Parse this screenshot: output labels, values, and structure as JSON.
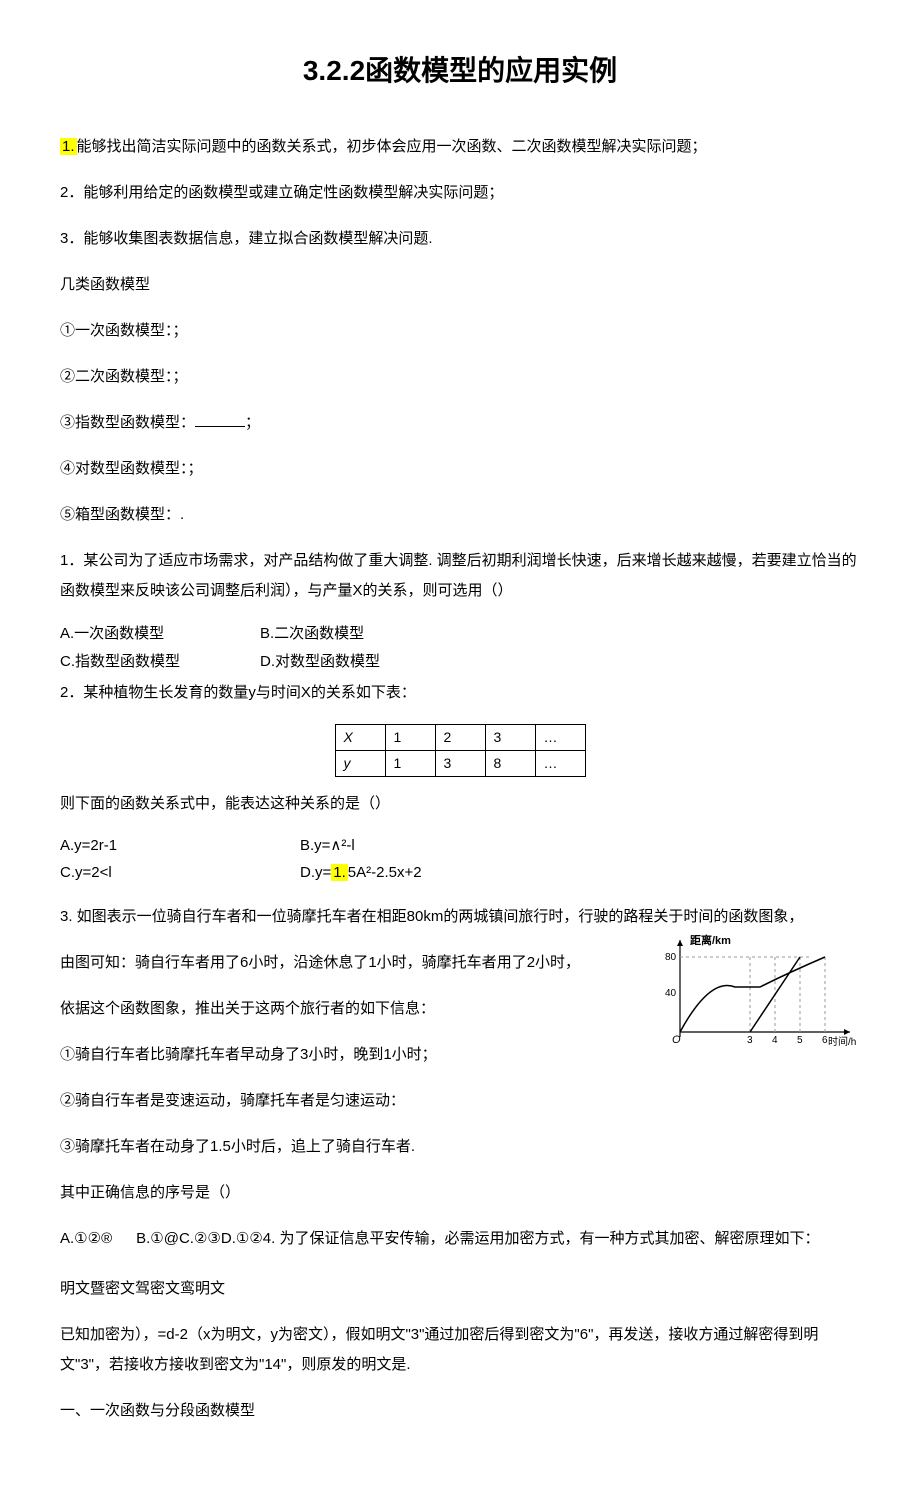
{
  "title": "3.2.2函数模型的应用实例",
  "p1_hi": "1.",
  "p1": "能够找出简洁实际问题中的函数关系式，初步体会应用一次函数、二次函数模型解决实际问题；",
  "p2": "2．能够利用给定的函数模型或建立确定性函数模型解决实际问题；",
  "p3": "3．能够收集图表数据信息，建立拟合函数模型解决问题.",
  "p4": "几类函数模型",
  "p5": "①一次函数模型：；",
  "p6": "②二次函数模型：；",
  "p7": "③指数型函数模型：",
  "p7b": "；",
  "p8": "④对数型函数模型：；",
  "p9": "⑤箱型函数模型：.",
  "q1": "1．某公司为了适应市场需求，对产品结构做了重大调整. 调整后初期利润增长快速，后来增长越来越慢，若要建立恰当的函数模型来反映该公司调整后利润），与产量X的关系，则可选用（）",
  "q1a": "A.一次函数模型",
  "q1b": "B.二次函数模型",
  "q1c": "C.指数型函数模型",
  "q1d": "D.对数型函数模型",
  "q2": "2．某种植物生长发育的数量y与时间X的关系如下表：",
  "table": {
    "h1": "X",
    "h2": "1",
    "h3": "2",
    "h4": "3",
    "h5": "…",
    "r1": "y",
    "r2": "1",
    "r3": "3",
    "r4": "8",
    "r5": "…"
  },
  "q2b": "则下面的函数关系式中，能表达这种关系的是（）",
  "q2a_a": "A.y=2r-1",
  "q2a_b": "B.y=∧²-l",
  "q2a_c": "C.y=2<l",
  "q2a_d_a": "D.y=",
  "q2a_d_h": "1.",
  "q2a_d_b": "5A²-2.5x+2",
  "q3a": "3. 如图表示一位骑自行车者和一位骑摩托车者在相距80km的两城镇间旅行时，行驶的路程关于时间的函数图象，",
  "q3b": "由图可知：骑自行车者用了6小时，沿途休息了1小时，骑摩托车者用了2小时，",
  "q3c": "依据这个函数图象，推出关于这两个旅行者的如下信息：",
  "q3d": "①骑自行车者比骑摩托车者早动身了3小时，晚到1小时；",
  "q3e": "②骑自行车者是变速运动，骑摩托车者是匀速运动：",
  "q3f": "③骑摩托车者在动身了1.5小时后，追上了骑自行车者.",
  "q3g": "其中正确信息的序号是（）",
  "q3opt_a": "A.①②®",
  "q3opt_b": "B.①@C.②③D.①②4. 为了保证信息平安传输，必需运用加密方式，有一种方式其加密、解密原理如下：",
  "q4a": "明文暨密文驾密文鸾明文",
  "q4b": "已知加密为），=d-2（x为明文，y为密文），假如明文\"3\"通过加密后得到密文为\"6\"，再发送，接收方通过解密得到明文\"3\"，若接收方接收到密文为\"14\"，则原发的明文是.",
  "sec": "一、一次函数与分段函数模型",
  "graph": {
    "ylabel": "距离/km",
    "xlabel": "时间/h",
    "y80": "80",
    "y40": "40",
    "o": "O",
    "x3": "3",
    "x4": "4",
    "x5": "5",
    "x6": "6"
  }
}
